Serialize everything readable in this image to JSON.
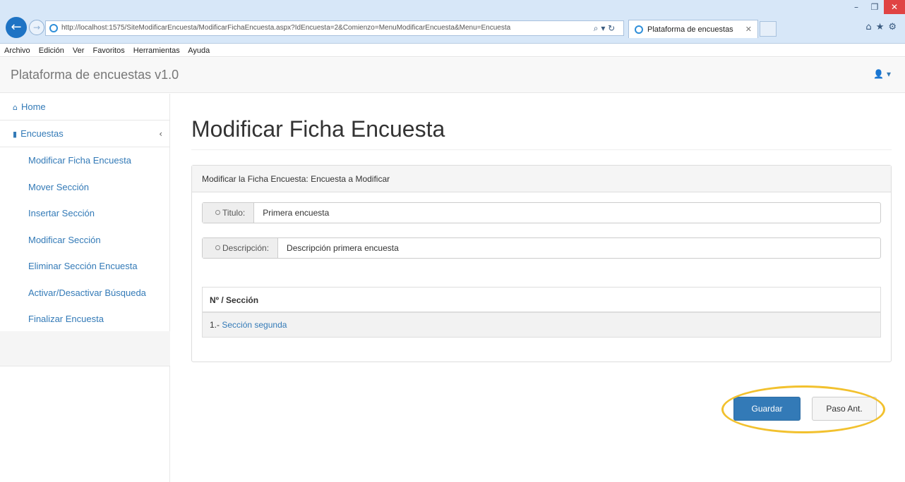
{
  "browser": {
    "url": "http://localhost:1575/SiteModificarEncuesta/ModificarFichaEncuesta.aspx?IdEncuesta=2&Comienzo=MenuModificarEncuesta&Menu=Encuesta",
    "tab_title": "Plataforma de encuestas",
    "menu": [
      "Archivo",
      "Edición",
      "Ver",
      "Favoritos",
      "Herramientas",
      "Ayuda"
    ]
  },
  "app": {
    "brand": "Plataforma de encuestas v1.0"
  },
  "sidebar": {
    "home": "Home",
    "section": "Encuestas",
    "items": [
      "Modificar Ficha Encuesta",
      "Mover Sección",
      "Insertar Sección",
      "Modificar Sección",
      "Eliminar Sección Encuesta",
      "Activar/Desactivar Búsqueda",
      "Finalizar Encuesta"
    ]
  },
  "main": {
    "title": "Modificar Ficha Encuesta",
    "panel_heading": "Modificar la Ficha Encuesta: Encuesta a Modificar",
    "fields": {
      "titulo_label": "Titulo:",
      "titulo_value": "Primera encuesta",
      "descripcion_label": "Descripción:",
      "descripcion_value": "Descripción primera encuesta"
    },
    "table": {
      "header": "Nº / Sección",
      "rows": [
        {
          "num": "1.-",
          "name": "Sección segunda"
        }
      ]
    },
    "buttons": {
      "save": "Guardar",
      "prev": "Paso Ant."
    }
  },
  "colors": {
    "primary": "#337ab7",
    "highlight": "#f2c12e"
  }
}
